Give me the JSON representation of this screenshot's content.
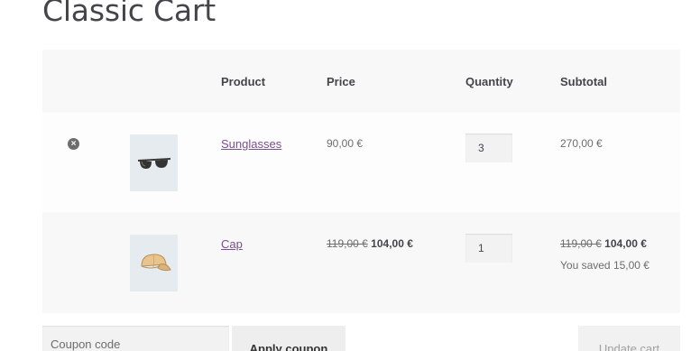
{
  "page": {
    "title": "Classic Cart"
  },
  "cart": {
    "headers": {
      "product": "Product",
      "price": "Price",
      "quantity": "Quantity",
      "subtotal": "Subtotal"
    },
    "items": [
      {
        "name": "Sunglasses",
        "price": "90,00 €",
        "quantity": "3",
        "subtotal": "270,00 €",
        "icon": "sunglasses-icon",
        "remove_icon": "×"
      },
      {
        "name": "Cap",
        "price_regular": "119,00 €",
        "price_sale": "104,00 €",
        "quantity": "1",
        "subtotal_regular": "119,00 €",
        "subtotal_sale": "104,00 €",
        "saved": "You saved 15,00 €",
        "icon": "cap-icon"
      }
    ]
  },
  "actions": {
    "coupon_placeholder": "Coupon code",
    "apply_coupon": "Apply coupon",
    "update_cart": "Update cart"
  },
  "colors": {
    "link": "#7a4e8e",
    "text": "#6d6d6d",
    "heading": "#43454b",
    "table_bg": "#f8f8f8"
  }
}
